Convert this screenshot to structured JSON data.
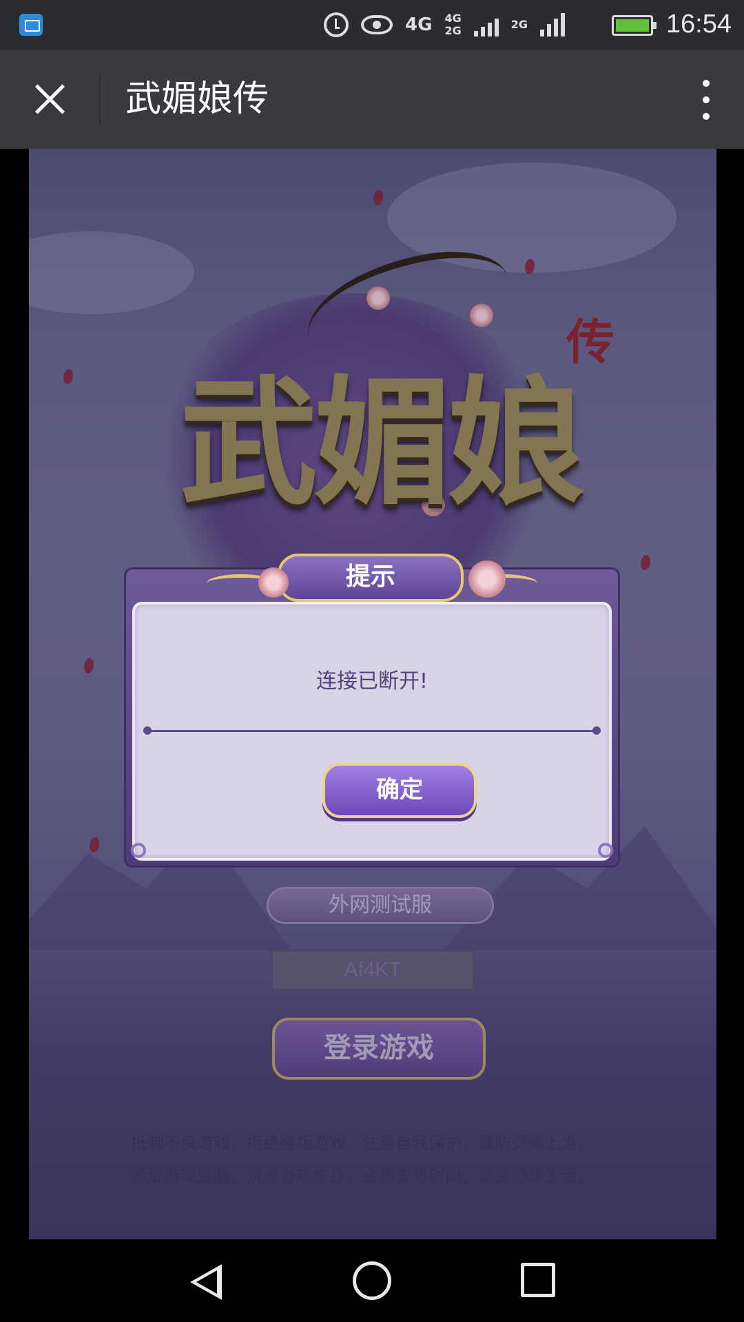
{
  "status_bar": {
    "network_main": "4G",
    "network_sub_top": "4G",
    "network_sub_bottom": "2G",
    "network_third": "2G",
    "time": "16:54",
    "battery": "charging"
  },
  "title_bar": {
    "title": "武媚娘传",
    "close_icon": "close-icon",
    "more_icon": "more-vertical-icon"
  },
  "game": {
    "logo_text": "武媚娘",
    "logo_seal": "传",
    "dialog": {
      "title": "提示",
      "message": "连接已断开!",
      "confirm_label": "确定"
    },
    "server_label": "外网测试服",
    "code_value": "Af4KT",
    "login_label": "登录游戏",
    "notice_line1": "抵制不良游戏，拒绝盗版游戏。注意自我保护，谨防受骗上当。",
    "notice_line2": "适度游戏益脑，沉迷游戏伤身。合理安排时间，享受健康生活。"
  },
  "nav_bar": {
    "back_icon": "back-triangle-icon",
    "home_icon": "home-circle-icon",
    "recent_icon": "recent-square-icon"
  },
  "colors": {
    "status_bar_bg": "#2b2c30",
    "title_bar_bg": "#393a3f",
    "dialog_accent": "#6b48b6",
    "gold_trim": "#e3c86e"
  }
}
